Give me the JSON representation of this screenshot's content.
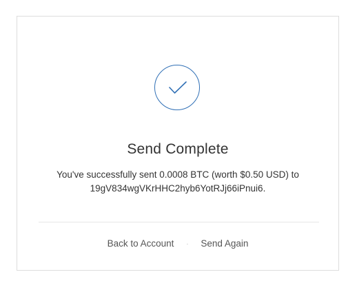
{
  "title": "Send Complete",
  "message": {
    "line1": "You've successfully sent 0.0008 BTC (worth $0.50 USD) to",
    "line2": "19gV834wgVKrHHC2hyb6YotRJj66iPnui6."
  },
  "actions": {
    "back_label": "Back to Account",
    "separator": "·",
    "send_again_label": "Send Again"
  },
  "icons": {
    "status": "checkmark-icon"
  },
  "colors": {
    "accent": "#2f6fb5"
  }
}
